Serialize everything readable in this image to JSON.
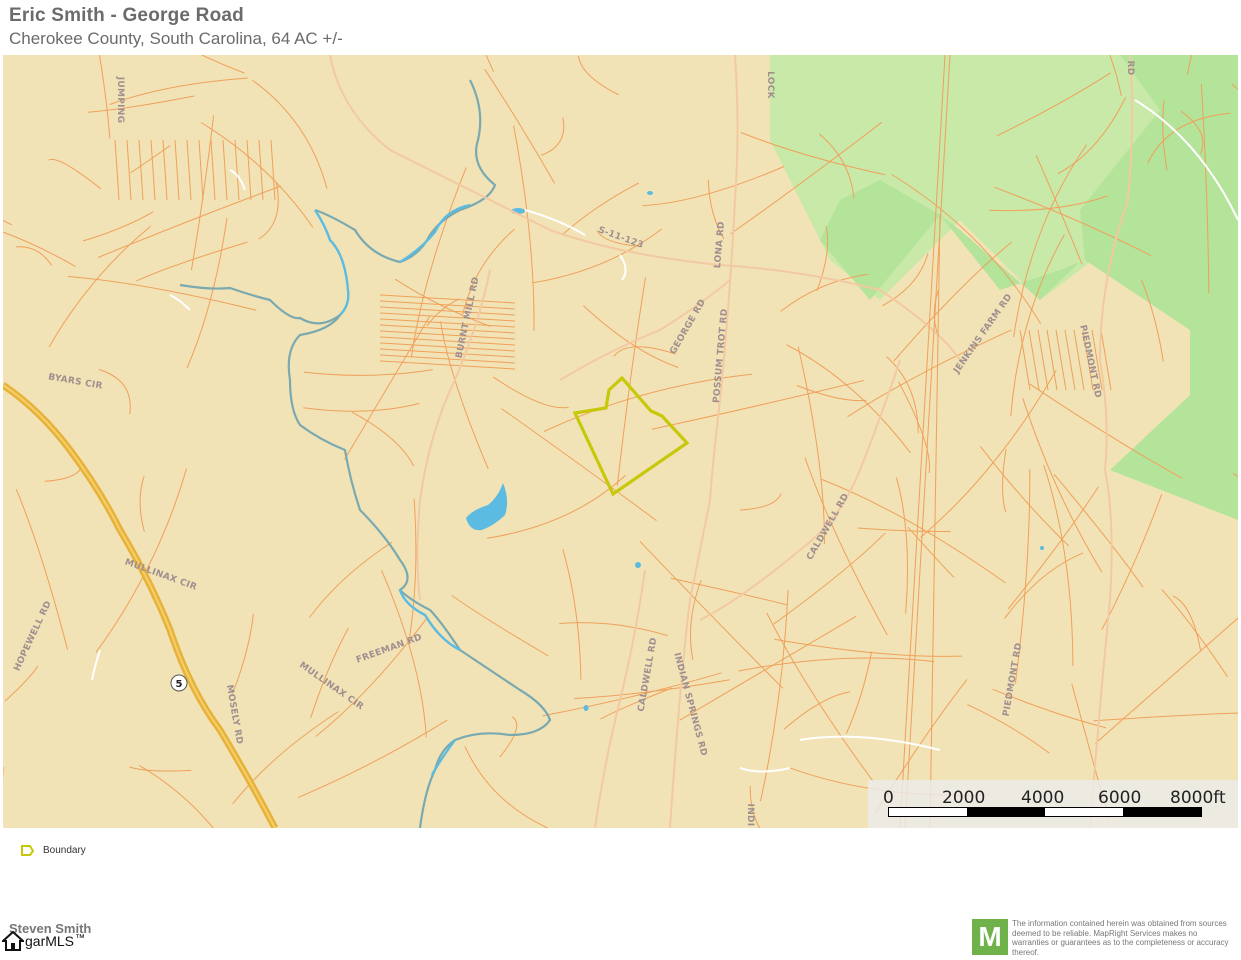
{
  "header": {
    "title": "Eric Smith - George Road",
    "subtitle": "Cherokee County, South Carolina, 64 AC +/-"
  },
  "map": {
    "colors": {
      "land": "#f1e3b6",
      "parcel_line": "#f0a05a",
      "water": "#5bbbe0",
      "creek": "#7aa9b0",
      "forest": "#b4e39a",
      "forest_light": "#c9e9a9",
      "highway": "#e8b23a",
      "boundary": "#c7c80a"
    },
    "road_labels": [
      {
        "text": "JUMPING",
        "rot": 90
      },
      {
        "text": "BYARS CIR",
        "rot": 10
      },
      {
        "text": "BURNT MILL RD",
        "rot": -78
      },
      {
        "text": "S-11-123",
        "rot": 20
      },
      {
        "text": "LONA RD",
        "rot": -85
      },
      {
        "text": "GEORGE RD",
        "rot": -60
      },
      {
        "text": "POSSUM TROT RD",
        "rot": -85
      },
      {
        "text": "JENKINS FARM RD",
        "rot": -55
      },
      {
        "text": "PIEDMONT RD",
        "rot": 78
      },
      {
        "text": "CALDWELL RD",
        "rot": -60
      },
      {
        "text": "MULLINAX CIR",
        "rot": 20
      },
      {
        "text": "HOPEWELL RD",
        "rot": -65
      },
      {
        "text": "FREEMAN RD",
        "rot": -20
      },
      {
        "text": "MULLINAX CIR",
        "rot": 35
      },
      {
        "text": "MOSELY RD",
        "rot": 80
      },
      {
        "text": "CALDWELL RD",
        "rot": -80
      },
      {
        "text": "INDIAN SPRINGS RD",
        "rot": 75
      },
      {
        "text": "PIEDMONT RD",
        "rot": -80
      },
      {
        "text": "LOCK",
        "rot": 90
      },
      {
        "text": "RD",
        "rot": 90
      },
      {
        "text": "INDI",
        "rot": 90
      }
    ],
    "route_shield": "5",
    "scale": {
      "labels": [
        "0",
        "2000",
        "4000",
        "6000",
        "8000ft"
      ]
    }
  },
  "legend": {
    "items": [
      {
        "label": "Boundary",
        "icon": "boundary-polygon-icon"
      }
    ]
  },
  "footer": {
    "agent_name": "Steven Smith",
    "mls_logo_text": "garMLS",
    "mls_trademark": "™",
    "mapright_logo_letter": "M",
    "disclaimer": "The information contained herein was obtained from sources deemed to be reliable. MapRight Services makes no warranties or guarantees as to the completeness or accuracy thereof."
  }
}
